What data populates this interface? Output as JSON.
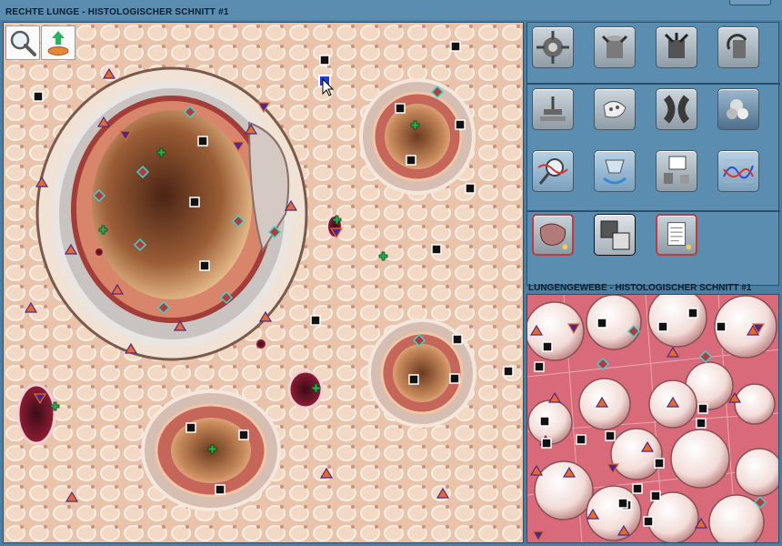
{
  "window": {
    "title": "RECHTE LUNGE - HISTOLOGISCHER SCHNITT #1"
  },
  "sub_view": {
    "title": "LUNGENGEWEBE - HISTOLOGISCHER SCHNITT #1"
  },
  "tools": {
    "zoom_icon": "magnifier-icon",
    "reset_icon": "reset-view-icon"
  },
  "buttons": [
    {
      "id": "target",
      "icon": "crosshair-target-icon"
    },
    {
      "id": "cylinder",
      "icon": "cylinder-icon"
    },
    {
      "id": "cylinder-open",
      "icon": "open-cylinder-icon"
    },
    {
      "id": "rotate",
      "icon": "rotate-object-icon"
    },
    {
      "id": "microscope",
      "icon": "microscope-icon"
    },
    {
      "id": "tissue",
      "icon": "tissue-sample-icon"
    },
    {
      "id": "x-shape",
      "icon": "x-shape-icon"
    },
    {
      "id": "cells",
      "icon": "cells-icon"
    },
    {
      "id": "magnify-graph",
      "icon": "magnify-graph-icon"
    },
    {
      "id": "cylinder-cycle",
      "icon": "cylinder-cycle-icon"
    },
    {
      "id": "slide-transfer",
      "icon": "slide-transfer-icon"
    },
    {
      "id": "graph",
      "icon": "graph-icon"
    },
    {
      "id": "specimen",
      "icon": "specimen-icon"
    },
    {
      "id": "window-switch",
      "icon": "window-switch-icon"
    },
    {
      "id": "documents",
      "icon": "documents-icon"
    }
  ],
  "colors": {
    "panel": "#5a8db0",
    "frame": "#2b4f6b",
    "marker_triangle": "#e8692e",
    "marker_diamond": "#37d5d0",
    "marker_square": "#000000",
    "marker_plus": "#22b14c"
  }
}
